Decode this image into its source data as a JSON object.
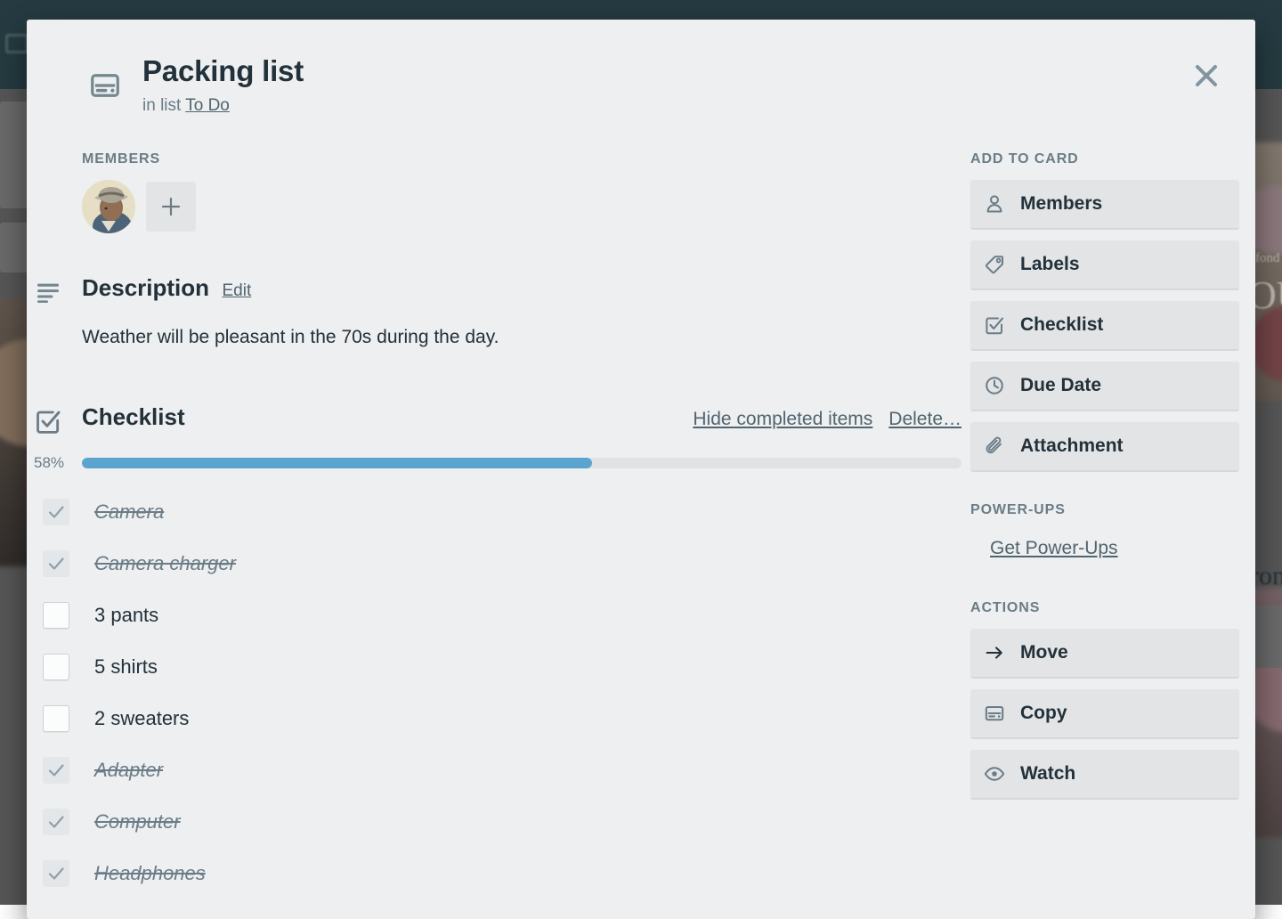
{
  "card": {
    "icon": "card-icon",
    "title": "Packing list",
    "in_list_prefix": "in list",
    "list_name": "To Do",
    "close_icon": "close-icon"
  },
  "members": {
    "label": "MEMBERS",
    "avatar_name": "member-avatar",
    "add_label": "+"
  },
  "description": {
    "icon": "description-lines-icon",
    "title": "Description",
    "edit_label": "Edit",
    "text": "Weather will be pleasant in the 70s during the day."
  },
  "checklist": {
    "icon": "checklist-icon",
    "title": "Checklist",
    "hide_completed_label": "Hide completed items",
    "delete_label": "Delete…",
    "progress_percent_label": "58%",
    "progress_percent": 58,
    "items": [
      {
        "label": "Camera",
        "checked": true
      },
      {
        "label": "Camera charger",
        "checked": true
      },
      {
        "label": "3 pants",
        "checked": false
      },
      {
        "label": "5 shirts",
        "checked": false
      },
      {
        "label": "2 sweaters",
        "checked": false
      },
      {
        "label": "Adapter",
        "checked": true
      },
      {
        "label": "Computer",
        "checked": true
      },
      {
        "label": "Headphones",
        "checked": true
      }
    ]
  },
  "sidebar": {
    "add_to_card": {
      "label": "ADD TO CARD",
      "buttons": [
        {
          "label": "Members",
          "icon": "person-icon"
        },
        {
          "label": "Labels",
          "icon": "tag-icon"
        },
        {
          "label": "Checklist",
          "icon": "checkbox-icon"
        },
        {
          "label": "Due Date",
          "icon": "clock-icon"
        },
        {
          "label": "Attachment",
          "icon": "paperclip-icon"
        }
      ]
    },
    "power_ups": {
      "label": "POWER-UPS",
      "link_label": "Get Power-Ups"
    },
    "actions": {
      "label": "ACTIONS",
      "buttons": [
        {
          "label": "Move",
          "icon": "arrow-right-icon"
        },
        {
          "label": "Copy",
          "icon": "card-icon"
        },
        {
          "label": "Watch",
          "icon": "eye-icon"
        }
      ]
    }
  },
  "colors": {
    "modal_bg": "#edeff0",
    "text_dark": "#23313a",
    "text_muted": "#6b7c87",
    "progress_fill": "#5ba4cf",
    "progress_track": "#dfe3e6",
    "button_bg": "#e2e4e6",
    "topbar": "#253b41"
  },
  "backdrop": {
    "fragment_1": "fond",
    "fragment_2": "OU",
    "fragment_3": "ron"
  }
}
